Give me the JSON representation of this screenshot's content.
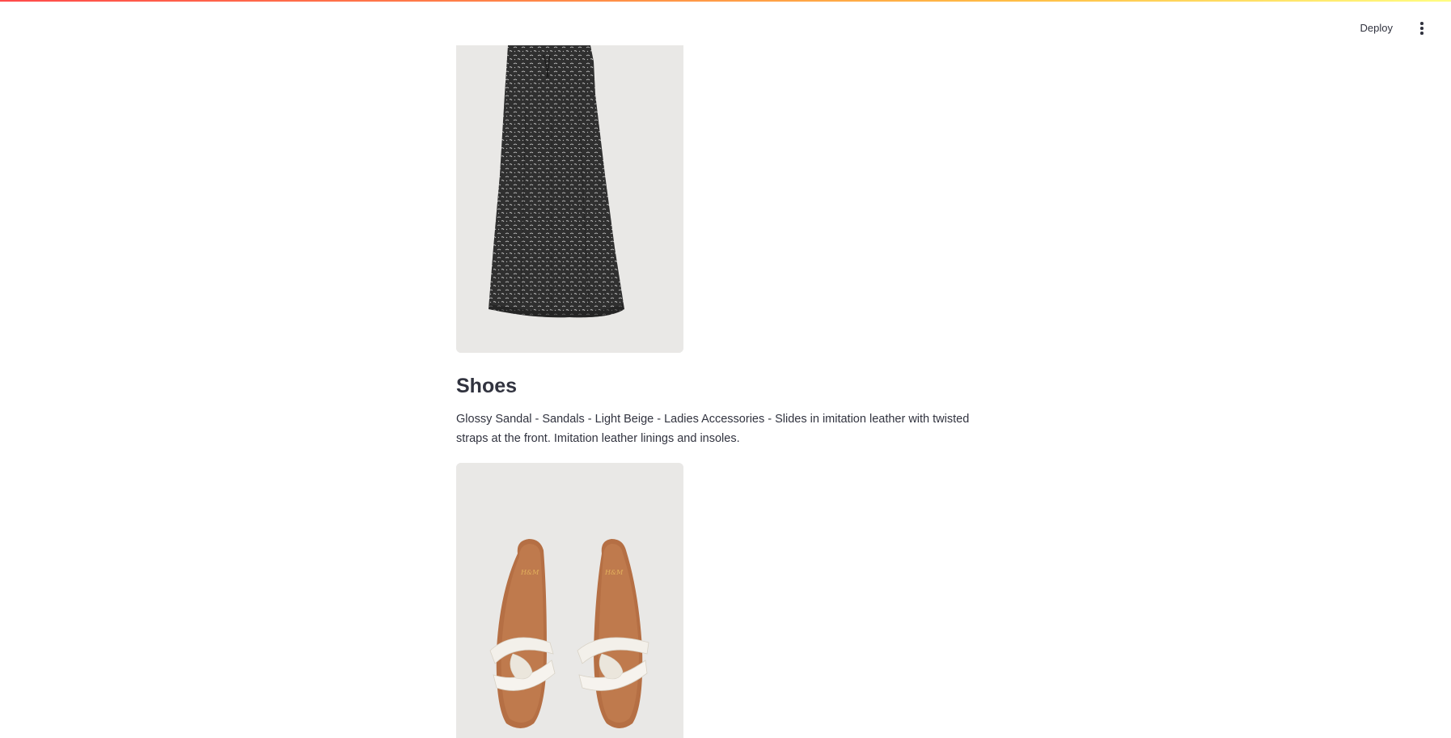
{
  "header": {
    "deploy_label": "Deploy",
    "menu_icon": "kebab-menu-icon"
  },
  "products": [
    {
      "category": "",
      "image_alt": "Black patterned skirt",
      "colors": {
        "fabric": "#2f2f2f",
        "pattern": "#d9d9d9",
        "background": "#e9e8e6"
      }
    },
    {
      "category": "Shoes",
      "description": "Glossy Sandal - Sandals - Light Beige - Ladies Accessories - Slides in imitation leather with twisted straps at the front. Imitation leather linings and insoles.",
      "image_alt": "Light beige slide sandals",
      "colors": {
        "sole": "#b56f44",
        "strap": "#f3f0ea",
        "background": "#e9e8e6"
      }
    }
  ],
  "theme": {
    "accent_start": "#ff4b4b",
    "accent_end": "#fffd80",
    "text": "#31333f"
  }
}
